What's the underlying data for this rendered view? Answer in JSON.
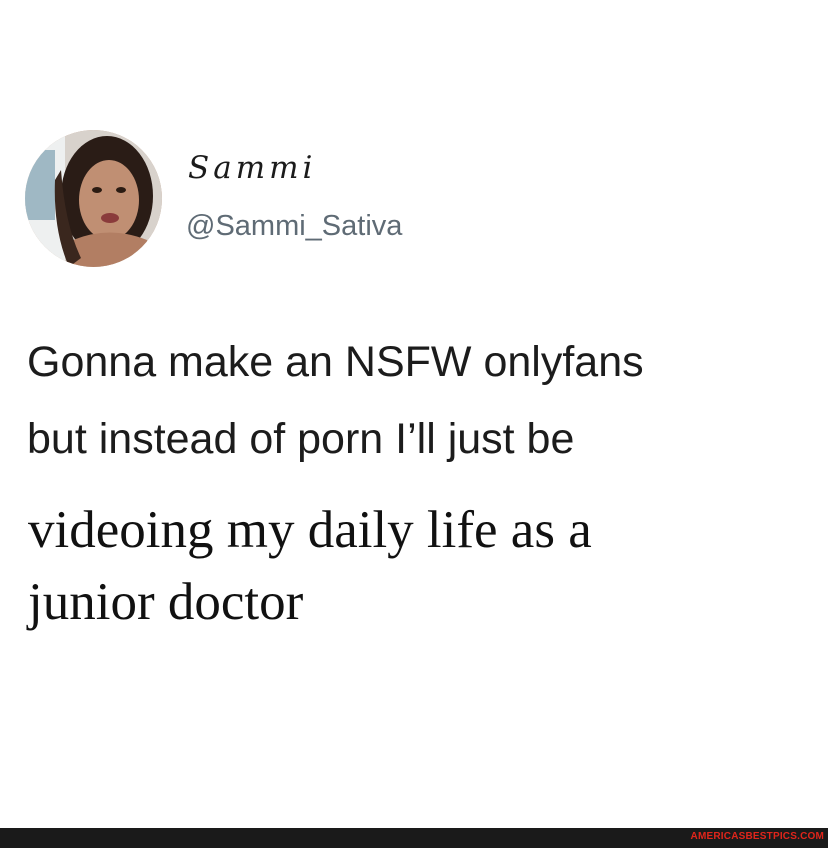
{
  "profile": {
    "display_name": "Sammi",
    "handle": "@Sammi_Sativa",
    "avatar_icon": "profile-photo"
  },
  "tweet": {
    "lines": [
      "Gonna make an NSFW onlyfans",
      "but instead of porn I’ll just be",
      "videoing my daily life as a",
      "junior doctor"
    ]
  },
  "footer": {
    "watermark": "AMERICASBESTPICS.COM",
    "watermark_color": "#e0251b",
    "bar_color": "#1a1a1a"
  }
}
